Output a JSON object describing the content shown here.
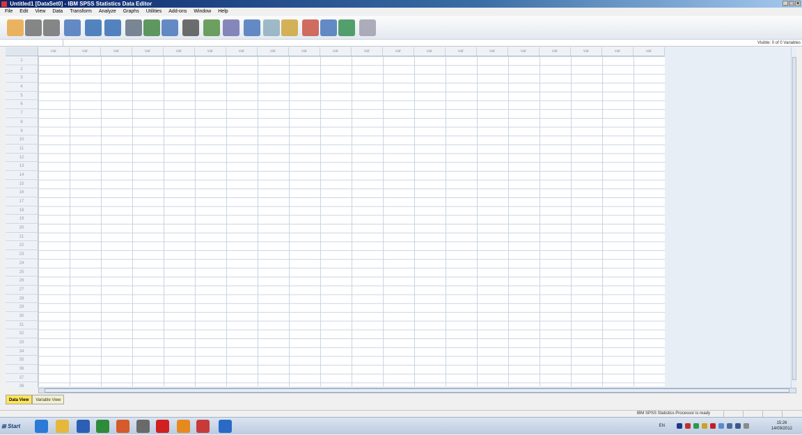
{
  "window": {
    "title": "Untitled1 [DataSet0] - IBM SPSS Statistics Data Editor"
  },
  "menu": [
    "File",
    "Edit",
    "View",
    "Data",
    "Transform",
    "Analyze",
    "Graphs",
    "Utilities",
    "Add-ons",
    "Window",
    "Help"
  ],
  "toolbar": {
    "icons": [
      "open-icon",
      "save-icon",
      "print-icon",
      "dialog-recall-icon",
      "undo-icon",
      "redo-icon",
      "goto-case-icon",
      "goto-variable-icon",
      "variables-icon",
      "find-icon",
      "insert-cases-icon",
      "insert-variable-icon",
      "split-file-icon",
      "weight-cases-icon",
      "select-cases-icon",
      "value-labels-icon",
      "use-sets-icon",
      "show-all-icon",
      "spelling-icon"
    ],
    "colors": [
      "#e8a23a",
      "#6a6a6a",
      "#6a6a6a",
      "#3f6fb6",
      "#2b66b0",
      "#2b66b0",
      "#5a6a7a",
      "#3a7f3a",
      "#3f6fb6",
      "#4a4a4a",
      "#4a8a3a",
      "#6a6aaa",
      "#3f6fb6",
      "#8ab",
      "#caa030",
      "#c84a3a",
      "#3f6fb6",
      "#2a8a4a",
      "#9a9aaa"
    ]
  },
  "formula": {
    "visible_text": "Visible: 0 of 0 Variables"
  },
  "grid": {
    "column_header": "var",
    "column_count": 20,
    "rows": [
      "1",
      "2",
      "3",
      "4",
      "5",
      "6",
      "7",
      "8",
      "9",
      "10",
      "11",
      "12",
      "13",
      "14",
      "15",
      "16",
      "17",
      "18",
      "19",
      "20",
      "21",
      "22",
      "23",
      "24",
      "25",
      "26",
      "27",
      "28",
      "29",
      "30",
      "31",
      "32",
      "33",
      "34",
      "35",
      "36",
      "37",
      "38"
    ]
  },
  "tabs": [
    {
      "label": "Data View",
      "active": true
    },
    {
      "label": "Variable View",
      "active": false
    }
  ],
  "status": {
    "message": "IBM SPSS Statistics Processor is ready"
  },
  "taskbar": {
    "start_label": "Start",
    "apps": [
      "ie-icon",
      "folder-icon",
      "word-icon",
      "excel-icon",
      "powerpoint-icon",
      "stat-icon",
      "paint-icon",
      "outlook-icon",
      "pdf-icon",
      "spss-icon"
    ],
    "app_colors": [
      "#2a7ad6",
      "#e6b73a",
      "#2b5fb5",
      "#2e8b3a",
      "#d65a2a",
      "#6a6a6a",
      "#d02020",
      "#e68a20",
      "#c83a3a",
      "#2a6ac6"
    ],
    "language": "EN",
    "time": "15:26",
    "date": "14/09/2012"
  }
}
